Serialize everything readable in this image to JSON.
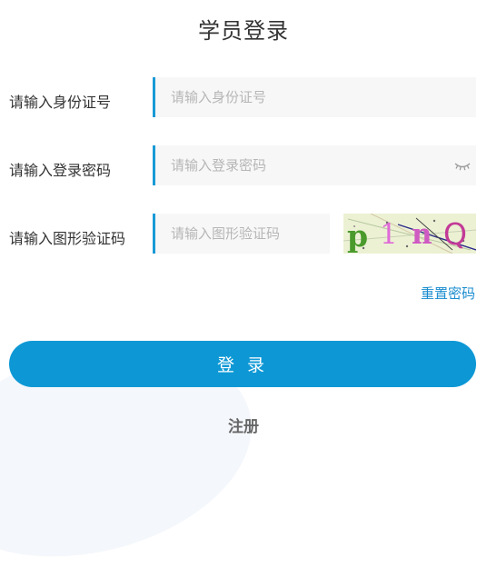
{
  "form": {
    "title": "学员登录",
    "id_number": {
      "label": "请输入身份证号",
      "placeholder": "请输入身份证号",
      "value": ""
    },
    "password": {
      "label": "请输入登录密码",
      "placeholder": "请输入登录密码",
      "value": "",
      "toggle_icon": "eye-closed-icon"
    },
    "captcha": {
      "label": "请输入图形验证码",
      "placeholder": "请输入图形验证码",
      "value": "",
      "image_text": "p1nQ"
    },
    "reset_password_label": "重置密码",
    "login_label": "登 录",
    "register_label": "注册"
  },
  "colors": {
    "accent": "#0d98d5",
    "field_border": "#1a9ad6",
    "field_bg": "#f7f7f7",
    "link": "#1a8ccf",
    "captcha_bg": "#ecf1d3"
  }
}
